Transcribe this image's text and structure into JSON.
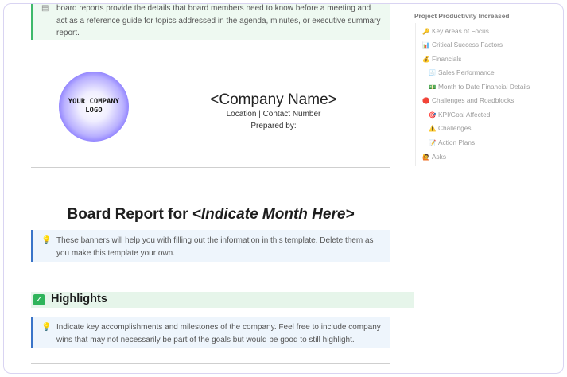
{
  "top_banner": {
    "line1": "board reports provide the details that board members need to know before a meeting and",
    "line2": "act as a reference guide for topics addressed in the agenda, minutes, or executive summary",
    "line3": "report."
  },
  "logo": {
    "line1": "YOUR COMPANY",
    "line2": "LOGO"
  },
  "header": {
    "company": "<Company Name>",
    "location": "Location | Contact Number",
    "prepared_by": "Prepared by:"
  },
  "report_title": {
    "prefix": "Board Report for ",
    "month": "<Indicate Month Here>"
  },
  "banner_template": {
    "line1": "These banners will help you with filling out the information in this template. Delete them as",
    "line2": "you make this template your own."
  },
  "highlights": {
    "title": "Highlights"
  },
  "banner_highlights": {
    "line1": "Indicate key accomplishments and milestones of the company. Feel free to include company",
    "line2": "wins that may not necessarily be part of the goals but would be good to still highlight."
  },
  "toc": {
    "heading": "Project Productivity Increased",
    "items": [
      {
        "label": "Key Areas of Focus",
        "icon": "key-icon",
        "glyph": "🔑"
      },
      {
        "label": "Critical Success Factors",
        "icon": "chart-icon",
        "glyph": "📊"
      },
      {
        "label": "Financials",
        "icon": "money-bag-icon",
        "glyph": "💰"
      },
      {
        "label": "Sales Performance",
        "icon": "receipt-icon",
        "glyph": "🧾"
      },
      {
        "label": "Month to Date Financial Details",
        "icon": "cash-icon",
        "glyph": "💵"
      },
      {
        "label": "Challenges and Roadblocks",
        "icon": "red-circle-icon",
        "glyph": "🔴"
      },
      {
        "label": "KPI/Goal Affected",
        "icon": "target-icon",
        "glyph": "🎯"
      },
      {
        "label": "Challenges",
        "icon": "warning-icon",
        "glyph": "⚠️"
      },
      {
        "label": "Action Plans",
        "icon": "memo-icon",
        "glyph": "📝"
      },
      {
        "label": "Asks",
        "icon": "raised-hand-icon",
        "glyph": "🙋"
      }
    ]
  },
  "colors": {
    "accent_blue": "#3a74c8",
    "accent_green": "#2fb45a",
    "logo_purple": "#7b6bff"
  }
}
